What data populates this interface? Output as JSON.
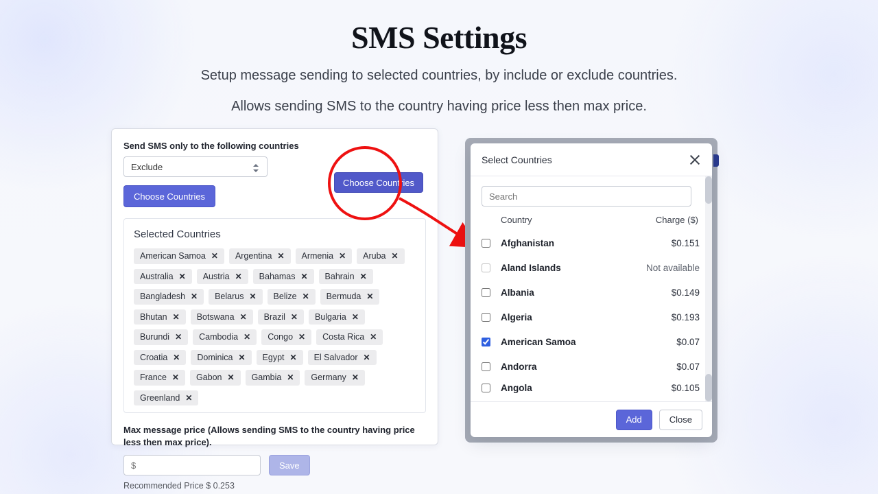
{
  "hero": {
    "title": "SMS Settings",
    "line1": "Setup message sending to selected countries, by include or exclude countries.",
    "line2": "Allows sending SMS to the country having price less then max price."
  },
  "left": {
    "send_label": "Send SMS only to the following countries",
    "mode_value": "Exclude",
    "choose_label": "Choose Countries",
    "selected_title": "Selected Countries",
    "chips": [
      "American Samoa",
      "Argentina",
      "Armenia",
      "Aruba",
      "Australia",
      "Austria",
      "Bahamas",
      "Bahrain",
      "Bangladesh",
      "Belarus",
      "Belize",
      "Bermuda",
      "Bhutan",
      "Botswana",
      "Brazil",
      "Bulgaria",
      "Burundi",
      "Cambodia",
      "Congo",
      "Costa Rica",
      "Croatia",
      "Dominica",
      "Egypt",
      "El Salvador",
      "France",
      "Gabon",
      "Gambia",
      "Germany",
      "Greenland"
    ],
    "max_label": "Max message price (Allows sending SMS to the country having price less then max price).",
    "price_placeholder": "$",
    "save_label": "Save",
    "recommended": "Recommended Price $ 0.253"
  },
  "floating": {
    "choose_label": "Choose Countries"
  },
  "modal": {
    "title": "Select Countries",
    "search_placeholder": "Search",
    "col_country": "Country",
    "col_charge": "Charge ($)",
    "rows": [
      {
        "name": "Afghanistan",
        "price": "$0.151",
        "checked": false,
        "available": true
      },
      {
        "name": "Aland Islands",
        "price": "Not available",
        "checked": false,
        "available": false
      },
      {
        "name": "Albania",
        "price": "$0.149",
        "checked": false,
        "available": true
      },
      {
        "name": "Algeria",
        "price": "$0.193",
        "checked": false,
        "available": true
      },
      {
        "name": "American Samoa",
        "price": "$0.07",
        "checked": true,
        "available": true
      },
      {
        "name": "Andorra",
        "price": "$0.07",
        "checked": false,
        "available": true
      },
      {
        "name": "Angola",
        "price": "$0.105",
        "checked": false,
        "available": true
      }
    ],
    "add_label": "Add",
    "close_label": "Close"
  }
}
